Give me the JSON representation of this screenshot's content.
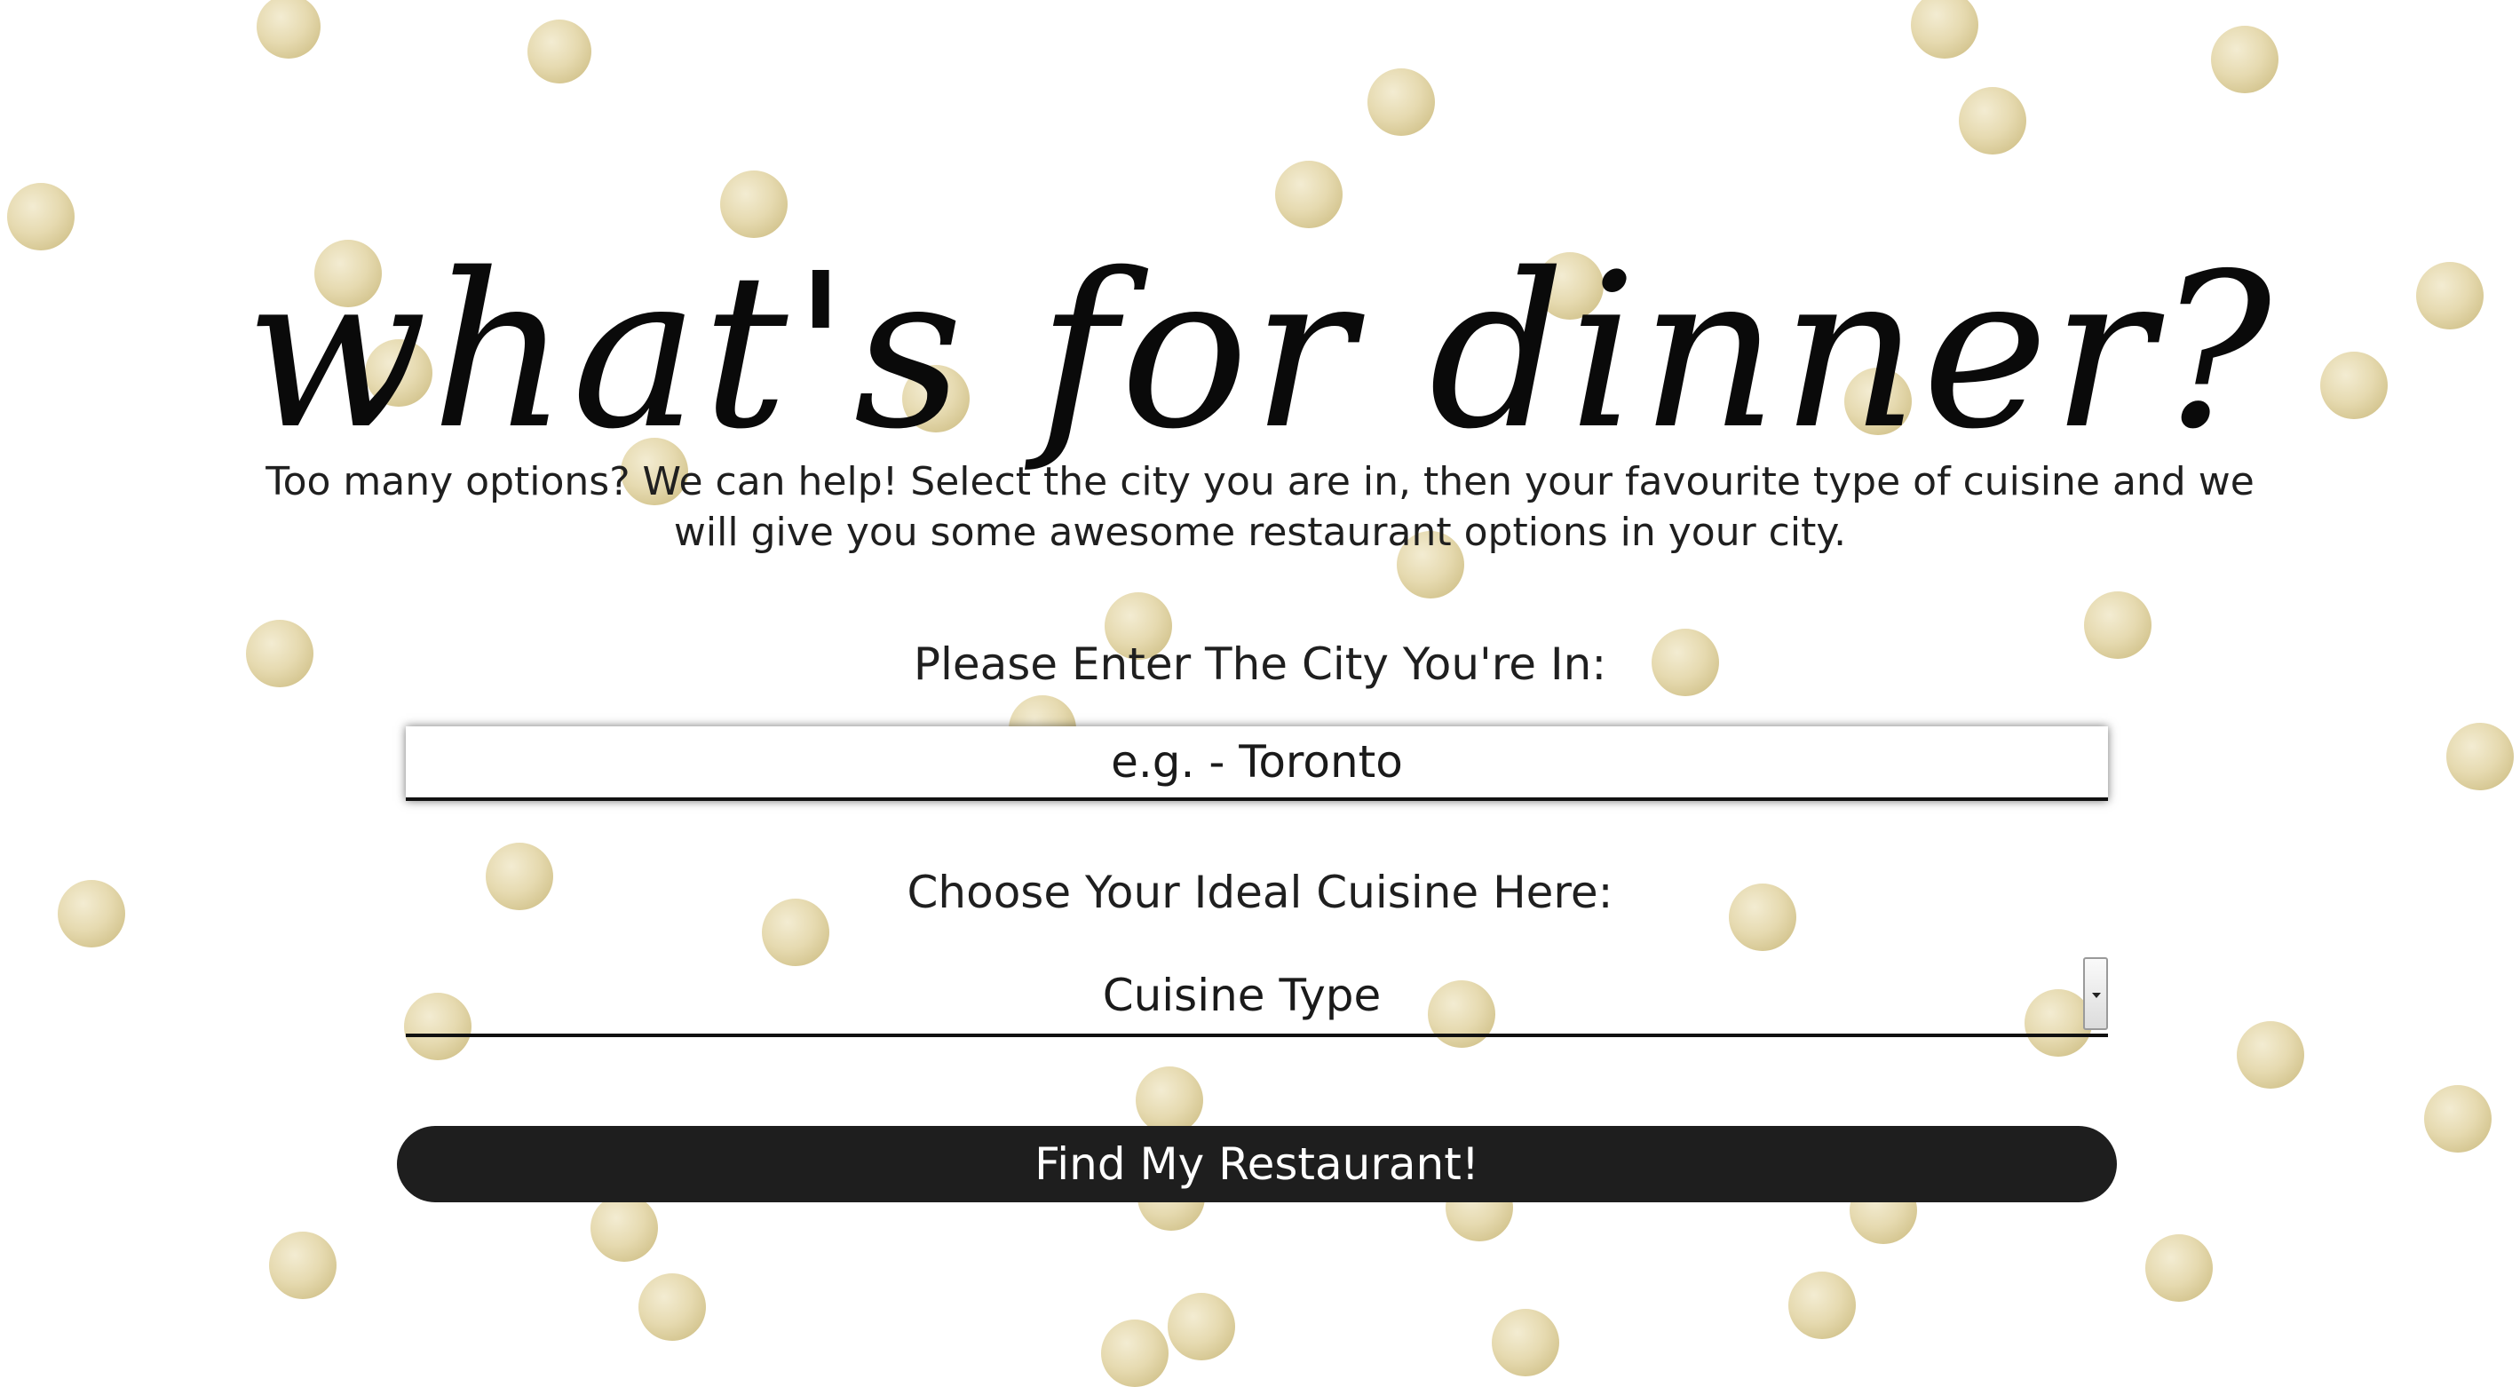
{
  "header": {
    "title": "what's for dinner?",
    "intro": "Too many options? We can help! Select the city you are in, then your favourite type of cuisine and we will give you some awesome restaurant options in your city."
  },
  "form": {
    "city_label": "Please Enter The City You're In:",
    "city_placeholder": "e.g. - Toronto",
    "city_value": "",
    "cuisine_label": "Choose Your Ideal Cuisine Here:",
    "cuisine_selected": "Cuisine Type",
    "submit_label": "Find My Restaurant!"
  },
  "theme": {
    "background": "#ffffff",
    "confetti_gold": "#e2d6a8",
    "button_bg": "#1e1e1e",
    "button_text": "#ffffff",
    "text": "#1a1a1a"
  }
}
